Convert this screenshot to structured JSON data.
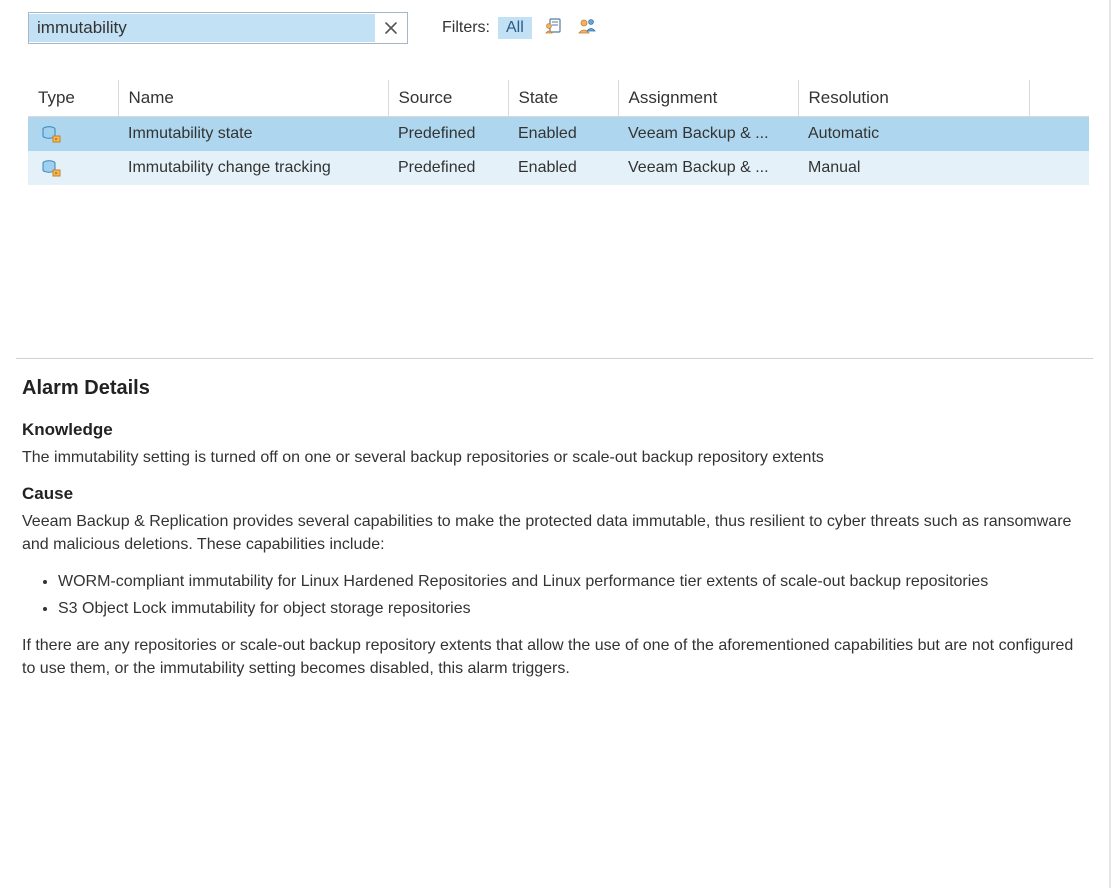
{
  "search": {
    "value": "immutability"
  },
  "filters": {
    "label": "Filters:",
    "all_label": "All"
  },
  "table": {
    "headers": {
      "type": "Type",
      "name": "Name",
      "source": "Source",
      "state": "State",
      "assignment": "Assignment",
      "resolution": "Resolution"
    },
    "rows": [
      {
        "name": "Immutability state",
        "source": "Predefined",
        "state": "Enabled",
        "assignment": "Veeam Backup & ...",
        "resolution": "Automatic"
      },
      {
        "name": "Immutability change tracking",
        "source": "Predefined",
        "state": "Enabled",
        "assignment": "Veeam Backup & ...",
        "resolution": "Manual"
      }
    ]
  },
  "details": {
    "title": "Alarm Details",
    "knowledge_heading": "Knowledge",
    "knowledge_text": "The immutability setting is turned off on one or several backup repositories or scale-out backup repository extents",
    "cause_heading": "Cause",
    "cause_text": "Veeam Backup & Replication provides several capabilities to make the protected data immutable, thus resilient to cyber threats such as ransomware and malicious deletions. These capabilities include:",
    "cause_bullets": [
      "WORM-compliant immutability for Linux Hardened Repositories and Linux performance tier extents of scale-out backup repositories",
      "S3 Object Lock immutability for object storage repositories"
    ],
    "cause_footer": "If there are any repositories or scale-out backup repository extents that allow the use of one of the aforementioned capabilities but are not configured to use them, or the immutability setting becomes disabled, this alarm triggers."
  }
}
